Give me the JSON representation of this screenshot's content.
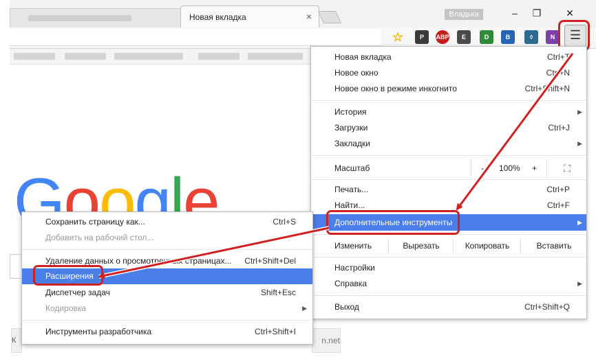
{
  "browser": {
    "active_tab_label": "Новая вкладка",
    "tab_close": "×",
    "user_name": "Владька",
    "window_minimize": "–",
    "window_restore": "❐",
    "window_close": "✕"
  },
  "toolbar": {
    "menu_icon": "☰",
    "extensions": [
      {
        "name": "star-icon",
        "glyph": "☆",
        "color": "#f0b400"
      },
      {
        "name": "pocket-icon",
        "glyph": "P",
        "color": "#3a3a3a"
      },
      {
        "name": "adblock-icon",
        "glyph": "ABP",
        "color": "#c81d1d"
      },
      {
        "name": "evernote-icon",
        "glyph": "E",
        "color": "#4a4a4a"
      },
      {
        "name": "green-badge-icon",
        "glyph": "D",
        "color": "#2f8a3a"
      },
      {
        "name": "book-icon",
        "glyph": "B",
        "color": "#2864b4"
      },
      {
        "name": "drop-icon",
        "glyph": "◊",
        "color": "#2d6a8f"
      },
      {
        "name": "onenote-icon",
        "glyph": "N",
        "color": "#7b3fa6"
      }
    ]
  },
  "page": {
    "logo_letters": [
      "G",
      "o",
      "o",
      "g",
      "l",
      "e"
    ],
    "bottom_tile_text": "n.net",
    "bottom_tile_letter": "К"
  },
  "menu": {
    "new_tab": "Новая вкладка",
    "new_tab_sc": "Ctrl+T",
    "new_window": "Новое окно",
    "new_window_sc": "Ctrl+N",
    "incognito": "Новое окно в режиме инкогнито",
    "incognito_sc": "Ctrl+Shift+N",
    "history": "История",
    "downloads": "Загрузки",
    "downloads_sc": "Ctrl+J",
    "bookmarks": "Закладки",
    "zoom_label": "Масштаб",
    "zoom_minus": "-",
    "zoom_value": "100%",
    "zoom_plus": "+",
    "fullscreen": "⛶",
    "print": "Печать...",
    "print_sc": "Ctrl+P",
    "find": "Найти...",
    "find_sc": "Ctrl+F",
    "more_tools": "Дополнительные инструменты",
    "edit_label": "Изменить",
    "cut": "Вырезать",
    "copy": "Копировать",
    "paste": "Вставить",
    "settings": "Настройки",
    "help": "Справка",
    "exit": "Выход",
    "exit_sc": "Ctrl+Shift+Q"
  },
  "submenu": {
    "save_page": "Сохранить страницу как...",
    "save_page_sc": "Ctrl+S",
    "add_desktop": "Добавить на рабочий стол...",
    "clear_data": "Удаление данных о просмотренных страницах...",
    "clear_data_sc": "Ctrl+Shift+Del",
    "extensions": "Расширения",
    "task_manager": "Диспетчер задач",
    "task_manager_sc": "Shift+Esc",
    "encoding": "Кодировка",
    "dev_tools": "Инструменты разработчика",
    "dev_tools_sc": "Ctrl+Shift+I"
  }
}
